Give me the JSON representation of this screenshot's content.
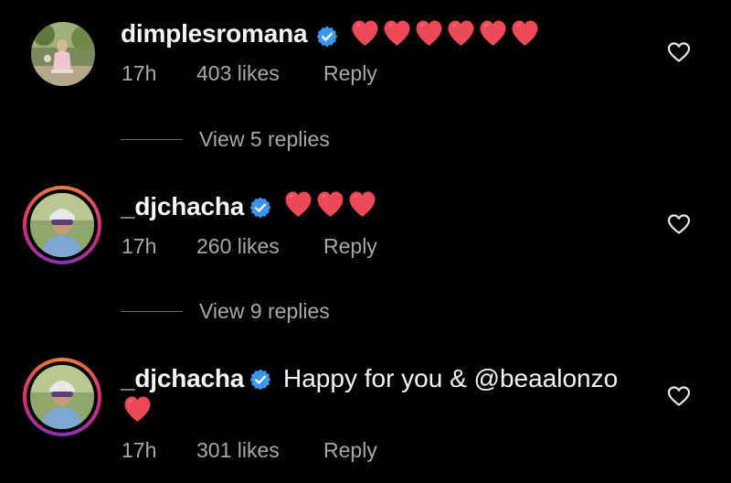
{
  "colors": {
    "background": "#000000",
    "text": "#f5f5f5",
    "secondary_text": "#a8a8a8",
    "verified_badge": "#3897f0",
    "heart": "#ed4956"
  },
  "comments": [
    {
      "username": "dimplesromana",
      "verified": true,
      "text": "",
      "emoji": "❤️❤️❤️❤️❤️❤️",
      "time": "17h",
      "likes": "403 likes",
      "reply_label": "Reply",
      "has_story_ring": false
    },
    {
      "username": "_djchacha",
      "verified": true,
      "text": "",
      "emoji": "❤️❤️❤️",
      "time": "17h",
      "likes": "260 likes",
      "reply_label": "Reply",
      "has_story_ring": true
    },
    {
      "username": "_djchacha",
      "verified": true,
      "text": "Happy for you & @beaalonzo",
      "emoji": "❤️",
      "time": "17h",
      "likes": "301 likes",
      "reply_label": "Reply",
      "has_story_ring": true
    }
  ],
  "view_replies": [
    {
      "label": "View 5 replies"
    },
    {
      "label": "View 9 replies"
    }
  ],
  "icons": {
    "verified": "verified-badge-icon",
    "like": "heart-outline-icon",
    "emoji": "red-heart-emoji-icon"
  }
}
